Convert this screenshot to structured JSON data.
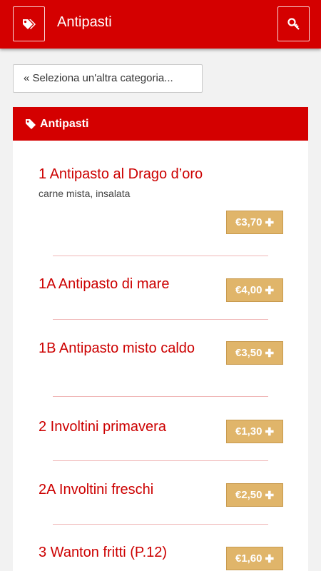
{
  "header": {
    "title": "Antipasti",
    "left_icon": "tags-icon",
    "right_icon": "key-icon"
  },
  "back_button": {
    "label": "« Seleziona un'altra categoria..."
  },
  "category": {
    "title": "Antipasti",
    "icon": "tag-icon"
  },
  "items": [
    {
      "name": "1 Antipasto al Drago d’oro",
      "description": "carne mista, insalata",
      "price": "€3,70"
    },
    {
      "name": "1A Antipasto di mare",
      "description": "",
      "price": "€4,00"
    },
    {
      "name": "1B Antipasto misto caldo",
      "description": "",
      "price": "€3,50"
    },
    {
      "name": "2 Involtini primavera",
      "description": "",
      "price": "€1,30"
    },
    {
      "name": "2A Involtini freschi",
      "description": "",
      "price": "€2,50"
    },
    {
      "name": "3 Wanton fritti (P.12)",
      "description": "",
      "price": "€1,60"
    }
  ],
  "colors": {
    "accent": "#d40000",
    "price_bg": "#e0b56a",
    "item_text": "#cc0000"
  }
}
